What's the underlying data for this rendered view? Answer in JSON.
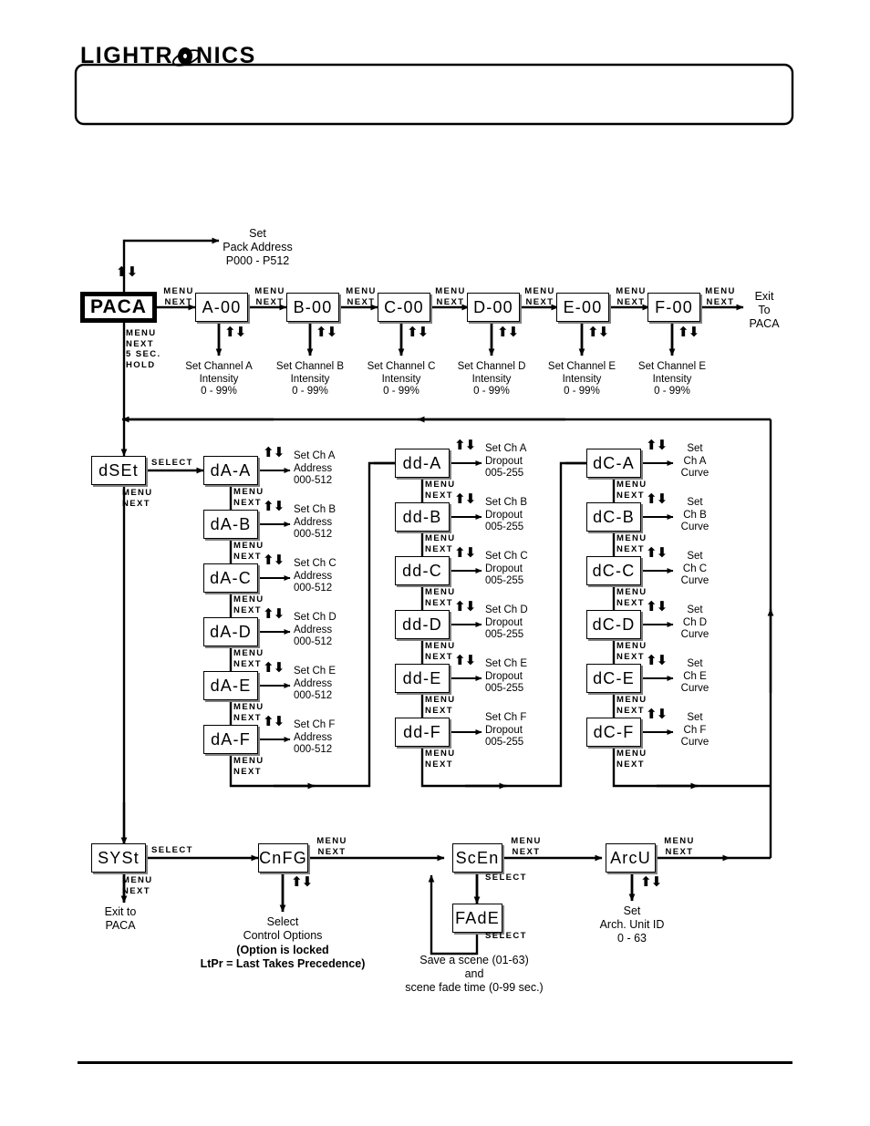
{
  "header": {
    "logo_text_before": "LIGHTR",
    "logo_text_after": "NICS",
    "logo_icon": "planet-orbit-icon"
  },
  "controls": {
    "menu_next": "MENU\nNEXT",
    "menu_next_hold": "MENU\nNEXT\n5 SEC.\nHOLD",
    "select": "SELECT",
    "updown": "⬆⬇"
  },
  "top_row": {
    "root": {
      "label": "PACA"
    },
    "root_hold_label": "MENU\nNEXT\n5 SEC.\nHOLD",
    "pack_address_note": "Set\nPack Address\nP000 - P512",
    "exit_note": "Exit\nTo\nPACA",
    "channels": [
      {
        "box": "A-00",
        "note": "Set Channel A\nIntensity\n0 - 99%",
        "step": "MENU\nNEXT"
      },
      {
        "box": "B-00",
        "note": "Set Channel B\nIntensity\n0 - 99%",
        "step": "MENU\nNEXT"
      },
      {
        "box": "C-00",
        "note": "Set Channel C\nIntensity\n0 - 99%",
        "step": "MENU\nNEXT"
      },
      {
        "box": "D-00",
        "note": "Set Channel D\nIntensity\n0 - 99%",
        "step": "MENU\nNEXT"
      },
      {
        "box": "E-00",
        "note": "Set Channel E\nIntensity\n0 - 99%",
        "step": "MENU\nNEXT"
      },
      {
        "box": "F-00",
        "note": "Set Channel E\nIntensity\n0 - 99%",
        "step": "MENU\nNEXT"
      }
    ]
  },
  "dset": {
    "root": {
      "label": "dSEt"
    },
    "root_step": "MENU\nNEXT",
    "select_label": "SELECT",
    "address_column": [
      {
        "box": "dA-A",
        "note": "Set Ch A\nAddress\n000-512",
        "step": "MENU\nNEXT"
      },
      {
        "box": "dA-B",
        "note": "Set Ch B\nAddress\n000-512",
        "step": "MENU\nNEXT"
      },
      {
        "box": "dA-C",
        "note": "Set Ch C\nAddress\n000-512",
        "step": "MENU\nNEXT"
      },
      {
        "box": "dA-D",
        "note": "Set Ch D\nAddress\n000-512",
        "step": "MENU\nNEXT"
      },
      {
        "box": "dA-E",
        "note": "Set Ch E\nAddress\n000-512",
        "step": "MENU\nNEXT"
      },
      {
        "box": "dA-F",
        "note": "Set Ch F\nAddress\n000-512",
        "step": "MENU\nNEXT"
      }
    ],
    "dropout_column": [
      {
        "box": "dd-A",
        "note": "Set Ch A\nDropout\n005-255",
        "step": "MENU\nNEXT"
      },
      {
        "box": "dd-B",
        "note": "Set Ch B\nDropout\n005-255",
        "step": "MENU\nNEXT"
      },
      {
        "box": "dd-C",
        "note": "Set Ch C\nDropout\n005-255",
        "step": "MENU\nNEXT"
      },
      {
        "box": "dd-D",
        "note": "Set Ch D\nDropout\n005-255",
        "step": "MENU\nNEXT"
      },
      {
        "box": "dd-E",
        "note": "Set Ch E\nDropout\n005-255",
        "step": "MENU\nNEXT"
      },
      {
        "box": "dd-F",
        "note": "Set Ch F\nDropout\n005-255",
        "step": "MENU\nNEXT"
      }
    ],
    "curve_column": [
      {
        "box": "dC-A",
        "note": "Set\nCh A\nCurve",
        "step": "MENU\nNEXT"
      },
      {
        "box": "dC-B",
        "note": "Set\nCh B\nCurve",
        "step": "MENU\nNEXT"
      },
      {
        "box": "dC-C",
        "note": "Set\nCh C\nCurve",
        "step": "MENU\nNEXT"
      },
      {
        "box": "dC-D",
        "note": "Set\nCh D\nCurve",
        "step": "MENU\nNEXT"
      },
      {
        "box": "dC-E",
        "note": "Set\nCh E\nCurve",
        "step": "MENU\nNEXT"
      },
      {
        "box": "dC-F",
        "note": "Set\nCh F\nCurve",
        "step": "MENU\nNEXT"
      }
    ]
  },
  "syst": {
    "root": {
      "label": "SYSt"
    },
    "root_step": "MENU\nNEXT",
    "select_label": "SELECT",
    "exit_note": "Exit to\nPACA",
    "cnfg": {
      "label": "CnFG"
    },
    "cnfg_step": "MENU\nNEXT",
    "cnfg_note": "Select\nControl Options",
    "cnfg_note_bold": "(Option is locked\nLtPr = Last Takes Precedence)",
    "scen": {
      "label": "ScEn"
    },
    "scen_step": "MENU\nNEXT",
    "scen_select": "SELECT",
    "fade": {
      "label": "FAdE"
    },
    "fade_select": "SELECT",
    "scene_note": "Save a scene (01-63)\nand\nscene fade time (0-99 sec.)",
    "arcu": {
      "label": "ArcU"
    },
    "arcu_step": "MENU\nNEXT",
    "arcu_note": "Set\nArch. Unit ID\n0 - 63"
  }
}
